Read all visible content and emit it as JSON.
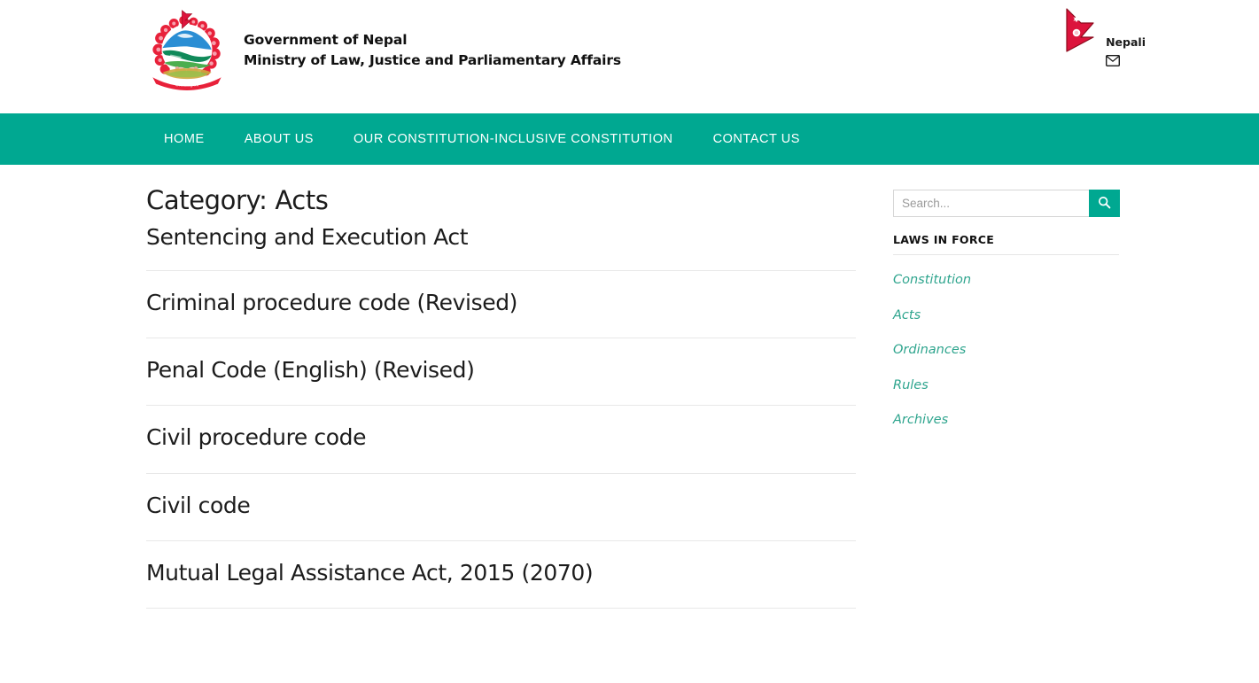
{
  "header": {
    "emblem_icon": "nepal-national-emblem",
    "org_line1": "Government of Nepal",
    "org_line2": "Ministry of Law, Justice and Parliamentary Affairs",
    "flag_icon": "nepal-flag-icon",
    "language_label": "Nepali",
    "mail_icon": "envelope-icon"
  },
  "nav": {
    "items": [
      {
        "label": "HOME"
      },
      {
        "label": "ABOUT US"
      },
      {
        "label": "OUR CONSTITUTION-INCLUSIVE CONSTITUTION"
      },
      {
        "label": "CONTACT US"
      }
    ]
  },
  "main": {
    "page_title": "Category: Acts",
    "entries": [
      {
        "title": "Sentencing and Execution Act"
      },
      {
        "title": "Criminal procedure code (Revised)"
      },
      {
        "title": "Penal Code (English) (Revised)"
      },
      {
        "title": "Civil procedure code"
      },
      {
        "title": "Civil code"
      },
      {
        "title": "Mutual Legal Assistance Act, 2015 (2070)"
      }
    ]
  },
  "sidebar": {
    "search": {
      "placeholder": "Search...",
      "value": "",
      "button_icon": "search-icon"
    },
    "widget_title": "LAWS IN FORCE",
    "links": [
      {
        "label": "Constitution"
      },
      {
        "label": "Acts"
      },
      {
        "label": "Ordinances"
      },
      {
        "label": "Rules"
      },
      {
        "label": "Archives"
      }
    ]
  },
  "colors": {
    "accent_teal": "#00a891",
    "link_teal": "#2fa58e",
    "flag_red": "#dc143c",
    "flag_blue": "#003893",
    "divider": "#e8e8e8"
  }
}
